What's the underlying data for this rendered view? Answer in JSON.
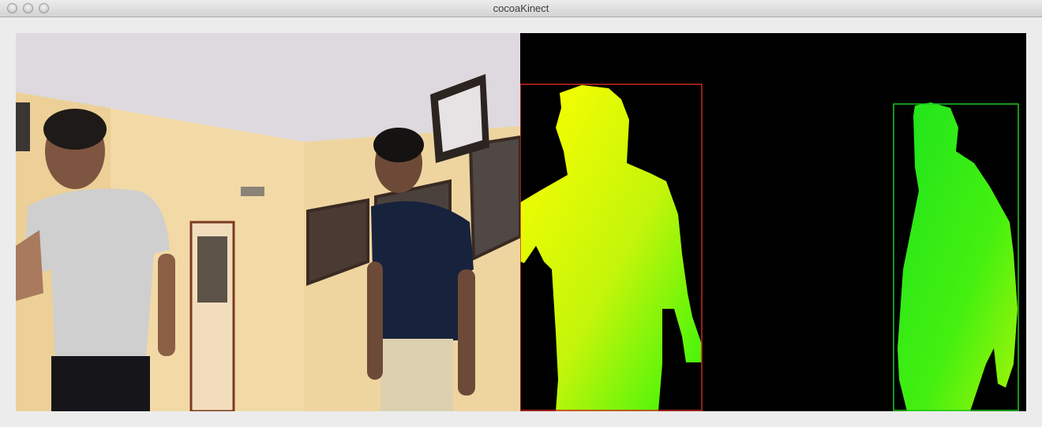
{
  "window": {
    "title": "cocoaKinect"
  },
  "controls": {
    "close": "close-button",
    "minimize": "minimize-button",
    "zoom": "zoom-button"
  },
  "views": {
    "rgb": "rgb-camera-view",
    "depth": "depth-camera-view"
  },
  "depth": {
    "tracked_users": [
      {
        "box_color": "#cc2b1d",
        "fill_top": "#ffff00",
        "fill_bottom": "#2ef50a"
      },
      {
        "box_color": "#1fc51f",
        "fill_top": "#1ee41e",
        "fill_bottom": "#a6f50a"
      }
    ]
  }
}
